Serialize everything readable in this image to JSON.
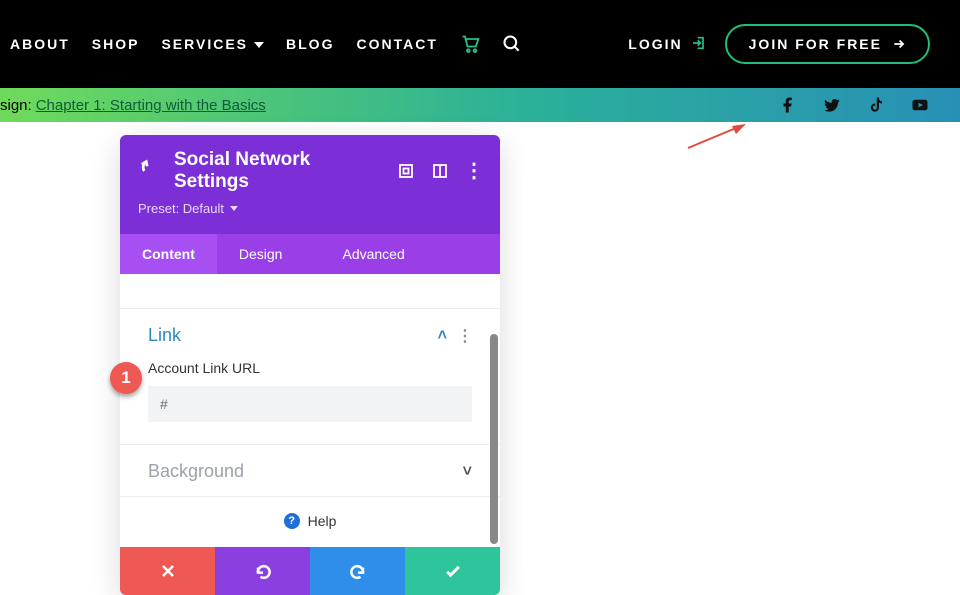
{
  "nav": {
    "about": "ABOUT",
    "shop": "SHOP",
    "services": "SERVICES",
    "blog": "BLOG",
    "contact": "CONTACT",
    "login": "LOGIN",
    "join": "JOIN FOR FREE"
  },
  "gradbar": {
    "prefix": "sign: ",
    "chapter_link": "Chapter 1: Starting with the Basics"
  },
  "panel": {
    "title": "Social Network Settings",
    "preset": "Preset: Default",
    "tabs": {
      "content": "Content",
      "design": "Design",
      "advanced": "Advanced"
    },
    "link_section": "Link",
    "url_label": "Account Link URL",
    "url_value": "#",
    "background_section": "Background",
    "help": "Help"
  },
  "marker": {
    "num": "1"
  }
}
